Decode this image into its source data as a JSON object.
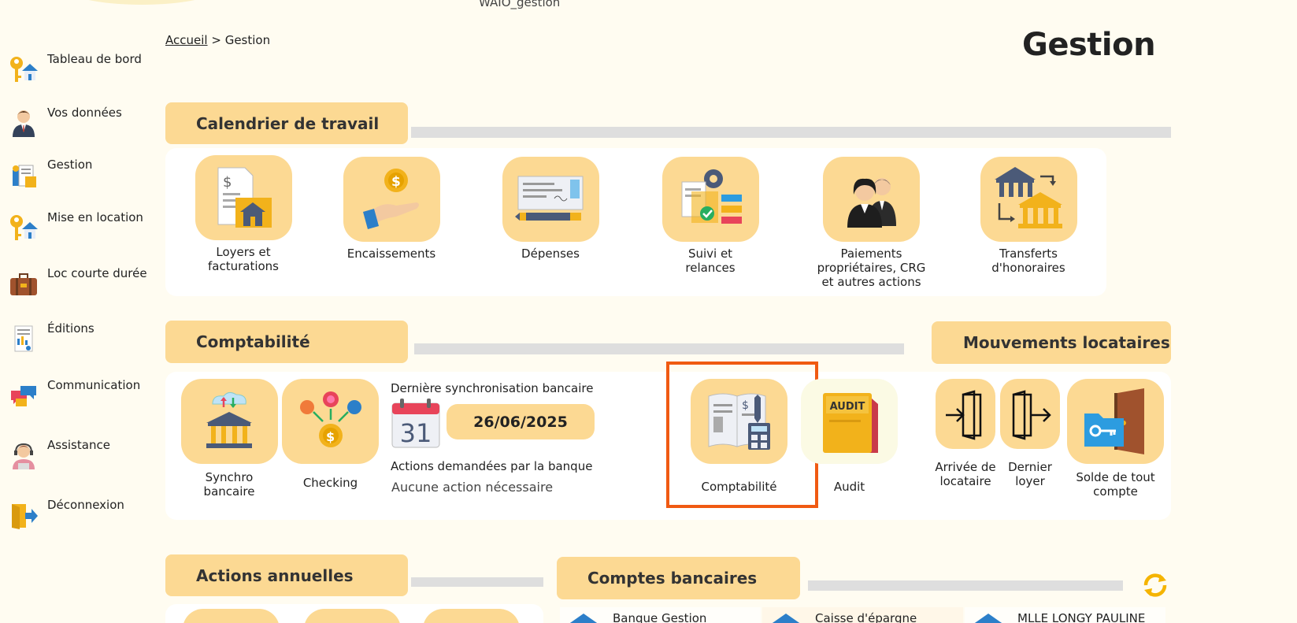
{
  "app_name": "WAIO_gestion",
  "breadcrumb": {
    "home": "Accueil",
    "separator": ">",
    "current": "Gestion"
  },
  "page_title": "Gestion",
  "sidebar": [
    {
      "label": "Tableau de bord",
      "icon": "key-house-icon"
    },
    {
      "label": "Vos données",
      "icon": "user-avatar-icon"
    },
    {
      "label": "Gestion",
      "icon": "management-icon"
    },
    {
      "label": "Mise en location",
      "icon": "key-house-icon"
    },
    {
      "label": "Loc courte durée",
      "icon": "suitcase-icon"
    },
    {
      "label": "Éditions",
      "icon": "report-icon"
    },
    {
      "label": "Communication",
      "icon": "chat-bubbles-icon"
    },
    {
      "label": "Assistance",
      "icon": "support-agent-icon"
    },
    {
      "label": "Déconnexion",
      "icon": "logout-icon"
    }
  ],
  "sections": {
    "calendar": {
      "title": "Calendrier de travail",
      "tiles": [
        {
          "label": "Loyers et\nfacturations",
          "icon": "rent-invoice-icon"
        },
        {
          "label": "Encaissements",
          "icon": "hand-coin-icon"
        },
        {
          "label": "Dépenses",
          "icon": "cheque-icon"
        },
        {
          "label": "Suivi et\nrelances",
          "icon": "followup-icon"
        },
        {
          "label": "Paiements\npropriétaires, CRG\net autres actions",
          "icon": "owners-icon"
        },
        {
          "label": "Transferts\nd'honoraires",
          "icon": "bank-transfer-icon"
        }
      ]
    },
    "accounting": {
      "title": "Comptabilité",
      "tiles": [
        {
          "label": "Synchro\nbancaire",
          "icon": "bank-sync-icon"
        },
        {
          "label": "Checking",
          "icon": "checking-icon"
        },
        {
          "label": "Comptabilité",
          "icon": "accounting-book-icon"
        },
        {
          "label": "Audit",
          "icon": "audit-folder-icon"
        }
      ],
      "last_sync_label": "Dernière synchronisation bancaire",
      "last_sync_date": "26/06/2025",
      "calendar_day": "31",
      "bank_actions_label": "Actions demandées par la banque",
      "bank_actions_value": "Aucune action nécessaire"
    },
    "tenant_moves": {
      "title": "Mouvements locataires",
      "tiles": [
        {
          "label": "Arrivée de\nlocataire",
          "icon": "door-enter-icon"
        },
        {
          "label": "Dernier\nloyer",
          "icon": "door-exit-icon"
        },
        {
          "label": "Solde de tout\ncompte",
          "icon": "folder-key-door-icon"
        }
      ]
    },
    "annual": {
      "title": "Actions annuelles"
    },
    "bank_accounts": {
      "title": "Comptes bancaires",
      "accounts": [
        {
          "label": "Banque Gestion"
        },
        {
          "label": "Caisse d'épargne"
        },
        {
          "label": "MLLE LONGY PAULINE"
        }
      ]
    }
  },
  "colors": {
    "background": "#fffcf1",
    "tile": "#fcd993",
    "highlight": "#f05a12",
    "bar": "#dedede",
    "refresh": "#f5b400"
  }
}
